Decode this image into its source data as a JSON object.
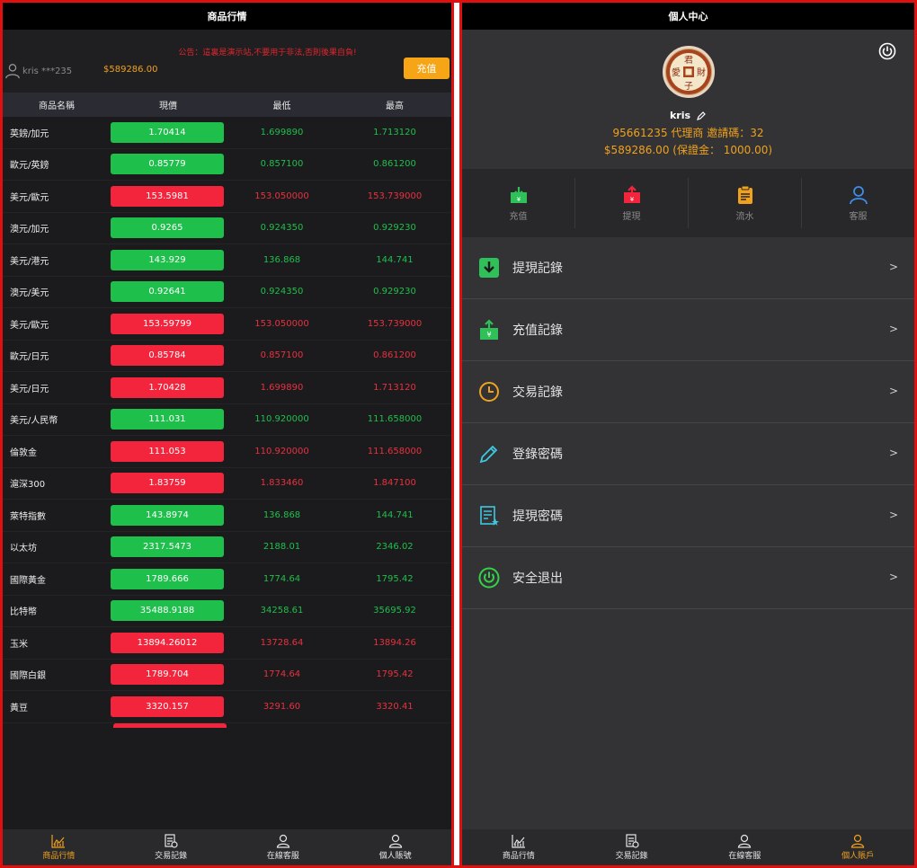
{
  "left": {
    "title": "商品行情",
    "notice": "公告：這裏是演示站,不要用于非法,否則後果自負!",
    "user": "kris ***235",
    "balance": "$589286.00",
    "recharge": "充值",
    "headers": [
      "商品名稱",
      "現價",
      "最低",
      "最高"
    ],
    "rows": [
      {
        "name": "英鎊/加元",
        "price": "1.70414",
        "low": "1.699890",
        "high": "1.713120",
        "dir": "up"
      },
      {
        "name": "歐元/英鎊",
        "price": "0.85779",
        "low": "0.857100",
        "high": "0.861200",
        "dir": "up"
      },
      {
        "name": "美元/歐元",
        "price": "153.5981",
        "low": "153.050000",
        "high": "153.739000",
        "dir": "down"
      },
      {
        "name": "澳元/加元",
        "price": "0.9265",
        "low": "0.924350",
        "high": "0.929230",
        "dir": "up"
      },
      {
        "name": "美元/港元",
        "price": "143.929",
        "low": "136.868",
        "high": "144.741",
        "dir": "up"
      },
      {
        "name": "澳元/美元",
        "price": "0.92641",
        "low": "0.924350",
        "high": "0.929230",
        "dir": "up"
      },
      {
        "name": "美元/歐元",
        "price": "153.59799",
        "low": "153.050000",
        "high": "153.739000",
        "dir": "down"
      },
      {
        "name": "歐元/日元",
        "price": "0.85784",
        "low": "0.857100",
        "high": "0.861200",
        "dir": "down"
      },
      {
        "name": "美元/日元",
        "price": "1.70428",
        "low": "1.699890",
        "high": "1.713120",
        "dir": "down"
      },
      {
        "name": "美元/人民幣",
        "price": "111.031",
        "low": "110.920000",
        "high": "111.658000",
        "dir": "up"
      },
      {
        "name": "倫敦金",
        "price": "111.053",
        "low": "110.920000",
        "high": "111.658000",
        "dir": "down"
      },
      {
        "name": "滬深300",
        "price": "1.83759",
        "low": "1.833460",
        "high": "1.847100",
        "dir": "down"
      },
      {
        "name": "萊特指數",
        "price": "143.8974",
        "low": "136.868",
        "high": "144.741",
        "dir": "up"
      },
      {
        "name": "以太坊",
        "price": "2317.5473",
        "low": "2188.01",
        "high": "2346.02",
        "dir": "up"
      },
      {
        "name": "國際黃金",
        "price": "1789.666",
        "low": "1774.64",
        "high": "1795.42",
        "dir": "up"
      },
      {
        "name": "比特幣",
        "price": "35488.9188",
        "low": "34258.61",
        "high": "35695.92",
        "dir": "up"
      },
      {
        "name": "玉米",
        "price": "13894.26012",
        "low": "13728.64",
        "high": "13894.26",
        "dir": "down"
      },
      {
        "name": "國際白銀",
        "price": "1789.704",
        "low": "1774.64",
        "high": "1795.42",
        "dir": "down"
      },
      {
        "name": "黃豆",
        "price": "3320.157",
        "low": "3291.60",
        "high": "3320.41",
        "dir": "down"
      }
    ],
    "tabs": [
      "商品行情",
      "交易記錄",
      "在線客服",
      "個人賬號"
    ]
  },
  "right": {
    "title": "個人中心",
    "avatar_text": "君愛財子",
    "username": "kris",
    "info_line1": "95661235 代理商   邀請碼：32",
    "info_line2": "$589286.00 (保證金： 1000.00)",
    "quick": [
      "充值",
      "提現",
      "流水",
      "客服"
    ],
    "menu": [
      "提現記錄",
      "充值記錄",
      "交易記錄",
      "登錄密碼",
      "提現密碼",
      "安全退出"
    ],
    "arrow": ">",
    "tabs": [
      "商品行情",
      "交易記錄",
      "在線客服",
      "個人賬戶"
    ]
  },
  "colors": {
    "up": "#1fbf4c",
    "down": "#f2253c",
    "accent": "#f0a11d"
  }
}
